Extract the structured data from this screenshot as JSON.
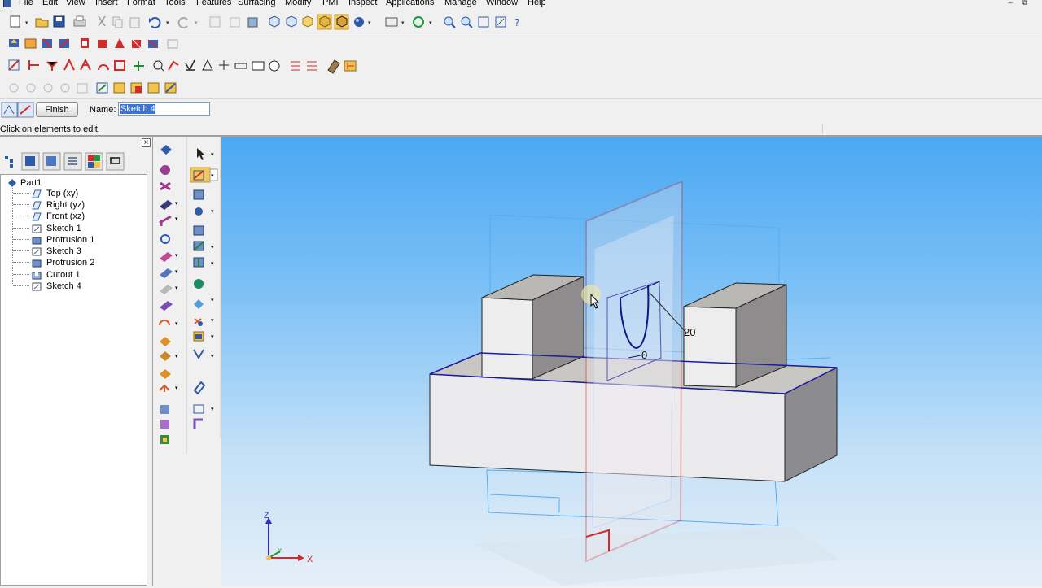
{
  "menu": {
    "items": [
      "File",
      "Edit",
      "View",
      "Insert",
      "Format",
      "Tools",
      "Features",
      "Surfacing",
      "Modify",
      "PMI",
      "Inspect",
      "Applications",
      "Manage",
      "Window",
      "Help"
    ]
  },
  "window_controls": {
    "minimize": "–",
    "restore": "⧉"
  },
  "sketch_ribbon": {
    "finish_label": "Finish",
    "name_label": "Name:",
    "name_value": "Sketch 4"
  },
  "prompt": {
    "text": "Click on elements to edit."
  },
  "pathfinder": {
    "close_glyph": "×",
    "root_label": "Part1",
    "items": [
      {
        "label": "Top (xy)",
        "icon": "plane-icon"
      },
      {
        "label": "Right (yz)",
        "icon": "plane-icon"
      },
      {
        "label": "Front (xz)",
        "icon": "plane-icon"
      },
      {
        "label": "Sketch 1",
        "icon": "sketch-icon"
      },
      {
        "label": "Protrusion 1",
        "icon": "protrusion-icon"
      },
      {
        "label": "Sketch 3",
        "icon": "sketch-icon"
      },
      {
        "label": "Protrusion 2",
        "icon": "protrusion-icon"
      },
      {
        "label": "Cutout 1",
        "icon": "cutout-icon"
      },
      {
        "label": "Sketch 4",
        "icon": "sketch-icon"
      }
    ]
  },
  "viewport": {
    "dimension_1": "20",
    "dimension_2": "0",
    "axis_z": "Z",
    "axis_x": "X",
    "axis_y": "Y"
  },
  "colors": {
    "sketch_plane": "#d42a2a",
    "viewport_top": "#4aa8f2",
    "pressed_button": "#f5c75a",
    "selection": "#3875d7"
  }
}
